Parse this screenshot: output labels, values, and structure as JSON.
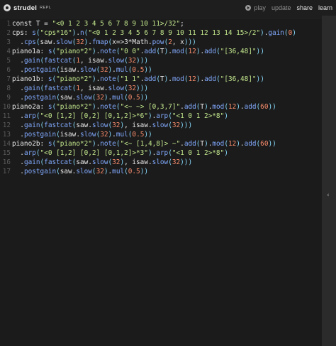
{
  "app": {
    "title": "strudel",
    "tag": "REPL"
  },
  "menu": {
    "play": "play",
    "update": "update",
    "share": "share",
    "learn": "learn"
  },
  "code_lines": [
    {
      "n": "1",
      "segs": [
        [
          "kw",
          "const T = "
        ],
        [
          "str",
          "\"<0 1 2 3 4 5 6 7 8 9 10 11>/32\""
        ],
        [
          "kw",
          ";"
        ]
      ]
    },
    {
      "n": "2",
      "segs": [
        [
          "kw",
          "cps: "
        ],
        [
          "fn",
          "s"
        ],
        [
          "pu",
          "("
        ],
        [
          "str",
          "\"cps*16\""
        ],
        [
          "pu",
          ")"
        ],
        [
          "kw",
          "."
        ],
        [
          "fn",
          "n"
        ],
        [
          "pu",
          "("
        ],
        [
          "str",
          "\"<0 1 2 3 4 5 6 7 8 9 10 11 12 13 14 15>/2\""
        ],
        [
          "pu",
          ")"
        ],
        [
          "kw",
          "."
        ],
        [
          "fn",
          "gain"
        ],
        [
          "pu",
          "("
        ],
        [
          "num",
          "0"
        ],
        [
          "pu",
          ")"
        ]
      ]
    },
    {
      "n": "3",
      "segs": [
        [
          "kw",
          "  ."
        ],
        [
          "fn",
          "cps"
        ],
        [
          "pu",
          "("
        ],
        [
          "kw",
          "saw."
        ],
        [
          "fn",
          "slow"
        ],
        [
          "pu",
          "("
        ],
        [
          "num",
          "32"
        ],
        [
          "pu",
          ")"
        ],
        [
          "kw",
          "."
        ],
        [
          "fn",
          "fmap"
        ],
        [
          "pu",
          "("
        ],
        [
          "kw",
          "x=>3*Math."
        ],
        [
          "fn",
          "pow"
        ],
        [
          "pu",
          "("
        ],
        [
          "num",
          "2"
        ],
        [
          "kw",
          ", x"
        ],
        [
          "pu",
          ")))"
        ]
      ]
    },
    {
      "n": "4",
      "segs": [
        [
          "kw",
          "piano1a: "
        ],
        [
          "fn",
          "s"
        ],
        [
          "pu",
          "("
        ],
        [
          "str",
          "\"piano*2\""
        ],
        [
          "pu",
          ")"
        ],
        [
          "kw",
          "."
        ],
        [
          "fn",
          "note"
        ],
        [
          "pu",
          "("
        ],
        [
          "str",
          "\"0 0\""
        ],
        [
          "kw",
          "."
        ],
        [
          "fn",
          "add"
        ],
        [
          "pu",
          "("
        ],
        [
          "kw",
          "T"
        ],
        [
          "pu",
          ")"
        ],
        [
          "kw",
          "."
        ],
        [
          "fn",
          "mod"
        ],
        [
          "pu",
          "("
        ],
        [
          "num",
          "12"
        ],
        [
          "pu",
          ")"
        ],
        [
          "kw",
          "."
        ],
        [
          "fn",
          "add"
        ],
        [
          "pu",
          "("
        ],
        [
          "str",
          "\"[36,48]\""
        ],
        [
          "pu",
          "))"
        ]
      ]
    },
    {
      "n": "5",
      "segs": [
        [
          "kw",
          "  ."
        ],
        [
          "fn",
          "gain"
        ],
        [
          "pu",
          "("
        ],
        [
          "fn",
          "fastcat"
        ],
        [
          "pu",
          "("
        ],
        [
          "num",
          "1"
        ],
        [
          "kw",
          ", isaw."
        ],
        [
          "fn",
          "slow"
        ],
        [
          "pu",
          "("
        ],
        [
          "num",
          "32"
        ],
        [
          "pu",
          ")))"
        ]
      ]
    },
    {
      "n": "6",
      "segs": [
        [
          "kw",
          "  ."
        ],
        [
          "fn",
          "postgain"
        ],
        [
          "pu",
          "("
        ],
        [
          "kw",
          "isaw."
        ],
        [
          "fn",
          "slow"
        ],
        [
          "pu",
          "("
        ],
        [
          "num",
          "32"
        ],
        [
          "pu",
          ")"
        ],
        [
          "kw",
          "."
        ],
        [
          "fn",
          "mul"
        ],
        [
          "pu",
          "("
        ],
        [
          "num",
          "0.5"
        ],
        [
          "pu",
          "))"
        ]
      ]
    },
    {
      "n": "7",
      "segs": [
        [
          "kw",
          "piano1b: "
        ],
        [
          "fn",
          "s"
        ],
        [
          "pu",
          "("
        ],
        [
          "str",
          "\"piano*2\""
        ],
        [
          "pu",
          ")"
        ],
        [
          "kw",
          "."
        ],
        [
          "fn",
          "note"
        ],
        [
          "pu",
          "("
        ],
        [
          "str",
          "\"1 1\""
        ],
        [
          "kw",
          "."
        ],
        [
          "fn",
          "add"
        ],
        [
          "pu",
          "("
        ],
        [
          "kw",
          "T"
        ],
        [
          "pu",
          ")"
        ],
        [
          "kw",
          "."
        ],
        [
          "fn",
          "mod"
        ],
        [
          "pu",
          "("
        ],
        [
          "num",
          "12"
        ],
        [
          "pu",
          ")"
        ],
        [
          "kw",
          "."
        ],
        [
          "fn",
          "add"
        ],
        [
          "pu",
          "("
        ],
        [
          "str",
          "\"[36,48]\""
        ],
        [
          "pu",
          "))"
        ]
      ]
    },
    {
      "n": "8",
      "segs": [
        [
          "kw",
          "  ."
        ],
        [
          "fn",
          "gain"
        ],
        [
          "pu",
          "("
        ],
        [
          "fn",
          "fastcat"
        ],
        [
          "pu",
          "("
        ],
        [
          "num",
          "1"
        ],
        [
          "kw",
          ", isaw."
        ],
        [
          "fn",
          "slow"
        ],
        [
          "pu",
          "("
        ],
        [
          "num",
          "32"
        ],
        [
          "pu",
          ")))"
        ]
      ]
    },
    {
      "n": "9",
      "segs": [
        [
          "kw",
          "  ."
        ],
        [
          "fn",
          "postgain"
        ],
        [
          "pu",
          "("
        ],
        [
          "kw",
          "saw."
        ],
        [
          "fn",
          "slow"
        ],
        [
          "pu",
          "("
        ],
        [
          "num",
          "32"
        ],
        [
          "pu",
          ")"
        ],
        [
          "kw",
          "."
        ],
        [
          "fn",
          "mul"
        ],
        [
          "pu",
          "("
        ],
        [
          "num",
          "0.5"
        ],
        [
          "pu",
          "))"
        ]
      ]
    },
    {
      "n": "10",
      "segs": [
        [
          "kw",
          "piano2a: "
        ],
        [
          "fn",
          "s"
        ],
        [
          "pu",
          "("
        ],
        [
          "str",
          "\"piano*2\""
        ],
        [
          "pu",
          ")"
        ],
        [
          "kw",
          "."
        ],
        [
          "fn",
          "note"
        ],
        [
          "pu",
          "("
        ],
        [
          "str",
          "\"<~ ~> [0,3,7]\""
        ],
        [
          "kw",
          "."
        ],
        [
          "fn",
          "add"
        ],
        [
          "pu",
          "("
        ],
        [
          "kw",
          "T"
        ],
        [
          "pu",
          ")"
        ],
        [
          "kw",
          "."
        ],
        [
          "fn",
          "mod"
        ],
        [
          "pu",
          "("
        ],
        [
          "num",
          "12"
        ],
        [
          "pu",
          ")"
        ],
        [
          "kw",
          "."
        ],
        [
          "fn",
          "add"
        ],
        [
          "pu",
          "("
        ],
        [
          "num",
          "60"
        ],
        [
          "pu",
          "))"
        ]
      ]
    },
    {
      "n": "11",
      "segs": [
        [
          "kw",
          "  ."
        ],
        [
          "fn",
          "arp"
        ],
        [
          "pu",
          "("
        ],
        [
          "str",
          "\"<0 [1,2] [0,2] [0,1,2]>*6\""
        ],
        [
          "pu",
          ")"
        ],
        [
          "kw",
          "."
        ],
        [
          "fn",
          "arp"
        ],
        [
          "pu",
          "("
        ],
        [
          "str",
          "\"<1 0 1 2>*8\""
        ],
        [
          "pu",
          ")"
        ]
      ]
    },
    {
      "n": "12",
      "segs": [
        [
          "kw",
          "  ."
        ],
        [
          "fn",
          "gain"
        ],
        [
          "pu",
          "("
        ],
        [
          "fn",
          "fastcat"
        ],
        [
          "pu",
          "("
        ],
        [
          "kw",
          "saw."
        ],
        [
          "fn",
          "slow"
        ],
        [
          "pu",
          "("
        ],
        [
          "num",
          "32"
        ],
        [
          "pu",
          ")"
        ],
        [
          "kw",
          ", isaw."
        ],
        [
          "fn",
          "slow"
        ],
        [
          "pu",
          "("
        ],
        [
          "num",
          "32"
        ],
        [
          "pu",
          ")))"
        ]
      ]
    },
    {
      "n": "13",
      "segs": [
        [
          "kw",
          "  ."
        ],
        [
          "fn",
          "postgain"
        ],
        [
          "pu",
          "("
        ],
        [
          "kw",
          "isaw."
        ],
        [
          "fn",
          "slow"
        ],
        [
          "pu",
          "("
        ],
        [
          "num",
          "32"
        ],
        [
          "pu",
          ")"
        ],
        [
          "kw",
          "."
        ],
        [
          "fn",
          "mul"
        ],
        [
          "pu",
          "("
        ],
        [
          "num",
          "0.5"
        ],
        [
          "pu",
          "))"
        ]
      ]
    },
    {
      "n": "14",
      "segs": [
        [
          "kw",
          "piano2b: "
        ],
        [
          "fn",
          "s"
        ],
        [
          "pu",
          "("
        ],
        [
          "str",
          "\"piano*2\""
        ],
        [
          "pu",
          ")"
        ],
        [
          "kw",
          "."
        ],
        [
          "fn",
          "note"
        ],
        [
          "pu",
          "("
        ],
        [
          "str",
          "\"<~ [1,4,8]> ~\""
        ],
        [
          "kw",
          "."
        ],
        [
          "fn",
          "add"
        ],
        [
          "pu",
          "("
        ],
        [
          "kw",
          "T"
        ],
        [
          "pu",
          ")"
        ],
        [
          "kw",
          "."
        ],
        [
          "fn",
          "mod"
        ],
        [
          "pu",
          "("
        ],
        [
          "num",
          "12"
        ],
        [
          "pu",
          ")"
        ],
        [
          "kw",
          "."
        ],
        [
          "fn",
          "add"
        ],
        [
          "pu",
          "("
        ],
        [
          "num",
          "60"
        ],
        [
          "pu",
          "))"
        ]
      ]
    },
    {
      "n": "15",
      "segs": [
        [
          "kw",
          "  ."
        ],
        [
          "fn",
          "arp"
        ],
        [
          "pu",
          "("
        ],
        [
          "str",
          "\"<0 [1,2] [0,2] [0,1,2]>*3\""
        ],
        [
          "pu",
          ")"
        ],
        [
          "kw",
          "."
        ],
        [
          "fn",
          "arp"
        ],
        [
          "pu",
          "("
        ],
        [
          "str",
          "\"<1 0 1 2>*8\""
        ],
        [
          "pu",
          ")"
        ]
      ]
    },
    {
      "n": "16",
      "segs": [
        [
          "kw",
          "  ."
        ],
        [
          "fn",
          "gain"
        ],
        [
          "pu",
          "("
        ],
        [
          "fn",
          "fastcat"
        ],
        [
          "pu",
          "("
        ],
        [
          "kw",
          "saw."
        ],
        [
          "fn",
          "slow"
        ],
        [
          "pu",
          "("
        ],
        [
          "num",
          "32"
        ],
        [
          "pu",
          ")"
        ],
        [
          "kw",
          ", isaw."
        ],
        [
          "fn",
          "slow"
        ],
        [
          "pu",
          "("
        ],
        [
          "num",
          "32"
        ],
        [
          "pu",
          ")))"
        ]
      ]
    },
    {
      "n": "17",
      "segs": [
        [
          "kw",
          "  ."
        ],
        [
          "fn",
          "postgain"
        ],
        [
          "pu",
          "("
        ],
        [
          "kw",
          "saw."
        ],
        [
          "fn",
          "slow"
        ],
        [
          "pu",
          "("
        ],
        [
          "num",
          "32"
        ],
        [
          "pu",
          ")"
        ],
        [
          "kw",
          "."
        ],
        [
          "fn",
          "mul"
        ],
        [
          "pu",
          "("
        ],
        [
          "num",
          "0.5"
        ],
        [
          "pu",
          "))"
        ]
      ]
    }
  ],
  "panel": {
    "toggle_glyph": "‹"
  },
  "colors": {
    "background": "#1e1e1e",
    "editor": "#1b1b1b",
    "string": "#c3e88d",
    "function": "#82aaff",
    "number": "#f78c6c",
    "punctuation": "#89ddff"
  }
}
